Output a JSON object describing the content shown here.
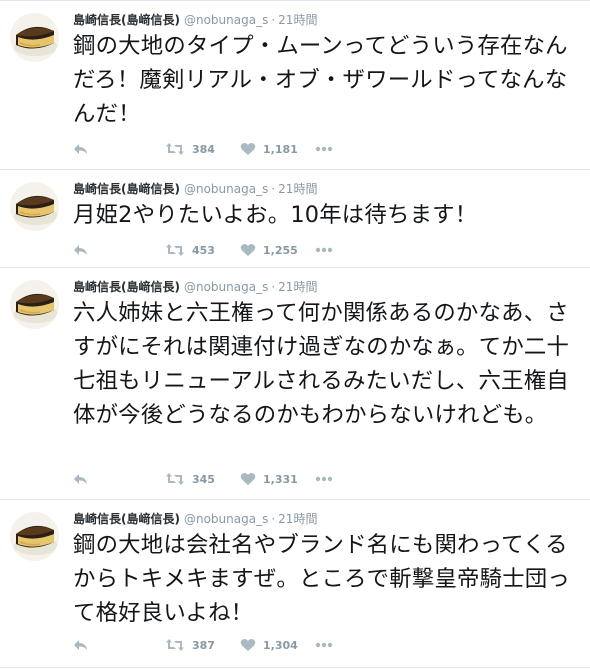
{
  "tweets": [
    {
      "fullname": "島崎信長(島﨑信長)",
      "screenname": "@nobunaga_s",
      "separator": "·",
      "time": "21時間",
      "text": "鋼の大地のタイプ・ムーンってどういう存在なんだろ！魔剣リアル・オブ・ザワールドってなんなんだ！",
      "retweets": "384",
      "likes": "1,181"
    },
    {
      "fullname": "島崎信長(島﨑信長)",
      "screenname": "@nobunaga_s",
      "separator": "·",
      "time": "21時間",
      "text": "月姫2やりたいよお。10年は待ちます！",
      "retweets": "453",
      "likes": "1,255"
    },
    {
      "fullname": "島崎信長(島﨑信長)",
      "screenname": "@nobunaga_s",
      "separator": "·",
      "time": "21時間",
      "text": "六人姉妹と六王権って何か関係あるのかなあ、さすがにそれは関連付け過ぎなのかなぁ。てか二十七祖もリニューアルされるみたいだし、六王権自体が今後どうなるのかもわからないけれども。",
      "retweets": "345",
      "likes": "1,331"
    },
    {
      "fullname": "島崎信長(島﨑信長)",
      "screenname": "@nobunaga_s",
      "separator": "·",
      "time": "21時間",
      "text": "鋼の大地は会社名やブランド名にも関わってくるからトキメキますぜ。ところで斬撃皇帝騎士団って格好良いよね！",
      "retweets": "387",
      "likes": "1,304"
    }
  ],
  "icons": {
    "reply": "reply-icon",
    "retweet": "retweet-icon",
    "like": "heart-icon",
    "more": "more-dots-icon",
    "avatar": "cheesecake-avatar"
  },
  "colors": {
    "name": "#292f33",
    "meta": "#8899a6",
    "text": "#14171a",
    "icon": "#aab8c2",
    "border": "#e1e8ed"
  }
}
